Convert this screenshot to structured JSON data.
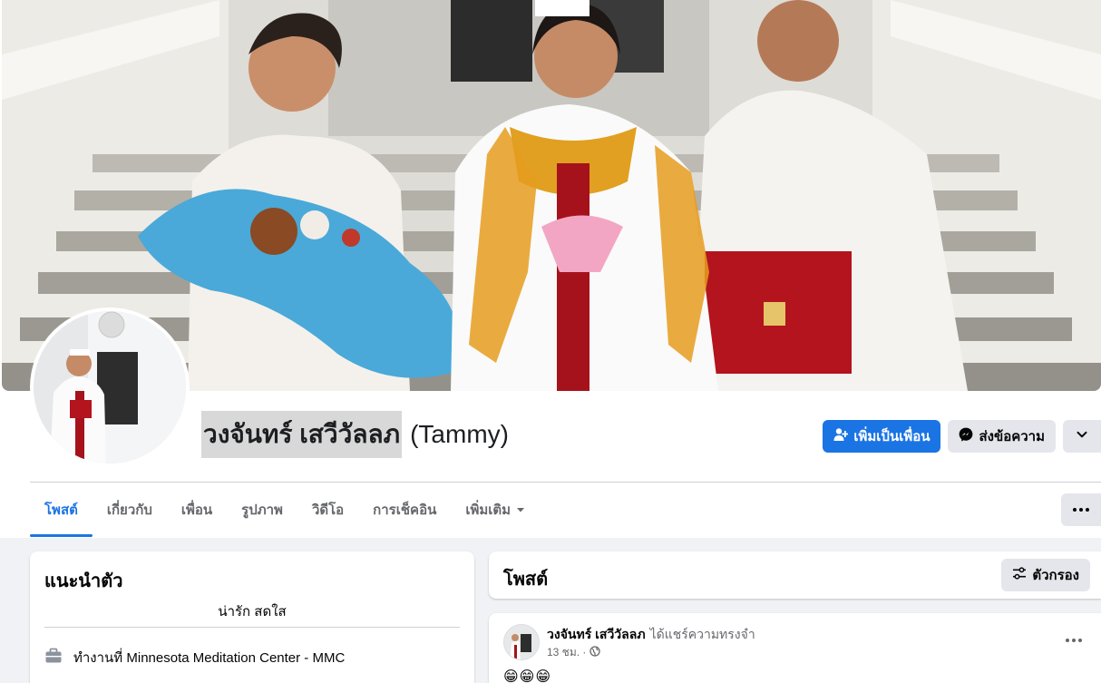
{
  "profile": {
    "name": "วงจันทร์ เสวีวัลลภ",
    "alt_name": "(Tammy)"
  },
  "actions": {
    "add_friend": "เพิ่มเป็นเพื่อน",
    "message": "ส่งข้อความ"
  },
  "tabs": [
    {
      "label": "โพสต์",
      "active": true
    },
    {
      "label": "เกี่ยวกับ"
    },
    {
      "label": "เพื่อน"
    },
    {
      "label": "รูปภาพ"
    },
    {
      "label": "วิดีโอ"
    },
    {
      "label": "การเช็คอิน"
    },
    {
      "label": "เพิ่มเติม"
    }
  ],
  "intro": {
    "title": "แนะนำตัว",
    "bio": "น่ารัก สดใส",
    "work": "ทำงานที่ Minnesota Meditation Center - MMC"
  },
  "posts": {
    "title": "โพสต์",
    "filter_label": "ตัวกรอง"
  },
  "post": {
    "author": "วงจันทร์ เสวีวัลลภ",
    "action": "ได้แชร์ความทรงจำ",
    "time": "13 ชม. ·",
    "text": "😁😁😁"
  },
  "colors": {
    "accent": "#1b74e4",
    "secondary_button": "#e4e6eb",
    "page_background": "#f0f2f5"
  },
  "icons": [
    "add-friend-icon",
    "messenger-icon",
    "chevron-down-icon",
    "more-dots-icon",
    "briefcase-icon",
    "filter-icon",
    "globe-icon",
    "caret-down-icon"
  ]
}
